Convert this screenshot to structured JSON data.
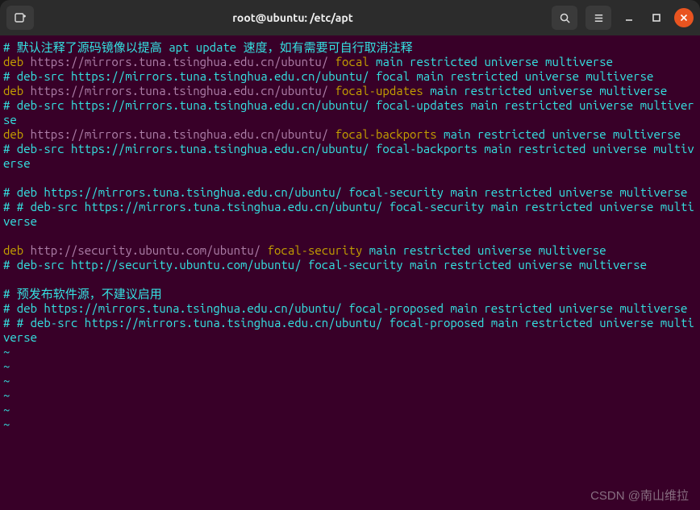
{
  "window": {
    "title": "root@ubuntu: /etc/apt"
  },
  "watermark": "CSDN @南山维拉",
  "lines": [
    {
      "t": "comment",
      "text": "# 默认注释了源码镜像以提高 apt update 速度，如有需要可自行取消注释"
    },
    {
      "t": "deb",
      "url": "https://mirrors.tuna.tsinghua.edu.cn/ubuntu/",
      "dist": "focal",
      "comps": "main restricted universe multiverse"
    },
    {
      "t": "comment",
      "text": "# deb-src https://mirrors.tuna.tsinghua.edu.cn/ubuntu/ focal main restricted universe multiverse"
    },
    {
      "t": "deb",
      "url": "https://mirrors.tuna.tsinghua.edu.cn/ubuntu/",
      "dist": "focal-updates",
      "comps": "main restricted universe multiverse"
    },
    {
      "t": "comment",
      "text": "# deb-src https://mirrors.tuna.tsinghua.edu.cn/ubuntu/ focal-updates main restricted universe multiverse"
    },
    {
      "t": "deb",
      "url": "https://mirrors.tuna.tsinghua.edu.cn/ubuntu/",
      "dist": "focal-backports",
      "comps": "main restricted universe multiverse"
    },
    {
      "t": "comment",
      "text": "# deb-src https://mirrors.tuna.tsinghua.edu.cn/ubuntu/ focal-backports main restricted universe multiverse"
    },
    {
      "t": "blank",
      "text": ""
    },
    {
      "t": "comment",
      "text": "# deb https://mirrors.tuna.tsinghua.edu.cn/ubuntu/ focal-security main restricted universe multiverse"
    },
    {
      "t": "comment",
      "text": "# # deb-src https://mirrors.tuna.tsinghua.edu.cn/ubuntu/ focal-security main restricted universe multiverse"
    },
    {
      "t": "blank",
      "text": ""
    },
    {
      "t": "deb",
      "url": "http://security.ubuntu.com/ubuntu/",
      "dist": "focal-security",
      "comps": "main restricted universe multiverse"
    },
    {
      "t": "comment",
      "text": "# deb-src http://security.ubuntu.com/ubuntu/ focal-security main restricted universe multiverse"
    },
    {
      "t": "blank",
      "text": ""
    },
    {
      "t": "comment",
      "text": "# 预发布软件源，不建议启用"
    },
    {
      "t": "comment",
      "text": "# deb https://mirrors.tuna.tsinghua.edu.cn/ubuntu/ focal-proposed main restricted universe multiverse"
    },
    {
      "t": "comment",
      "text": "# # deb-src https://mirrors.tuna.tsinghua.edu.cn/ubuntu/ focal-proposed main restricted universe multiverse"
    }
  ],
  "tildes": 6,
  "icons": {
    "newtab": "⊞",
    "search": "search",
    "menu": "menu",
    "minimize": "–",
    "maximize": "□",
    "close": "✕"
  }
}
